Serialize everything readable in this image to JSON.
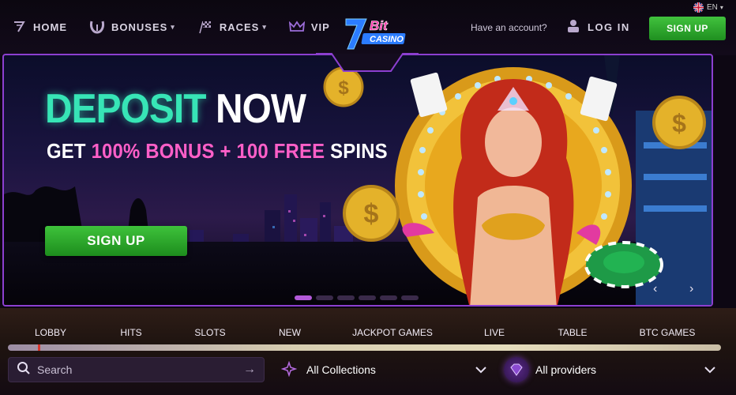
{
  "header": {
    "nav": [
      {
        "label": "HOME",
        "icon": "seven-icon",
        "caret": false
      },
      {
        "label": "BONUSES",
        "icon": "horseshoe-icon",
        "caret": true
      },
      {
        "label": "RACES",
        "icon": "checkered-flag-icon",
        "caret": true
      },
      {
        "label": "VIP",
        "icon": "crown-icon",
        "caret": false
      }
    ],
    "logo": {
      "top": "Bit",
      "bottom": "CASINO"
    },
    "language": "EN",
    "have_account": "Have an account?",
    "login_label": "LOG IN",
    "signup_label": "SIGN UP"
  },
  "hero": {
    "title_part1": "DEPOSIT",
    "title_part2": "NOW",
    "subtitle_part1": "GET ",
    "subtitle_part2": "100% BONUS + 100 FREE",
    "subtitle_part3": " SPINS",
    "signup_label": "SIGN UP",
    "slides_count": 6,
    "active_slide": 1
  },
  "game_tabs": [
    "LOBBY",
    "HITS",
    "SLOTS",
    "NEW",
    "JACKPOT GAMES",
    "LIVE",
    "TABLE",
    "BTC GAMES"
  ],
  "filters": {
    "search_placeholder": "Search",
    "collections_label": "All Collections",
    "providers_label": "All providers"
  },
  "colors": {
    "accent_green": "#3ec23b",
    "accent_purple": "#8c3fd0",
    "title_teal": "#37e5b6",
    "bonus_pink": "#ff5fc8"
  }
}
